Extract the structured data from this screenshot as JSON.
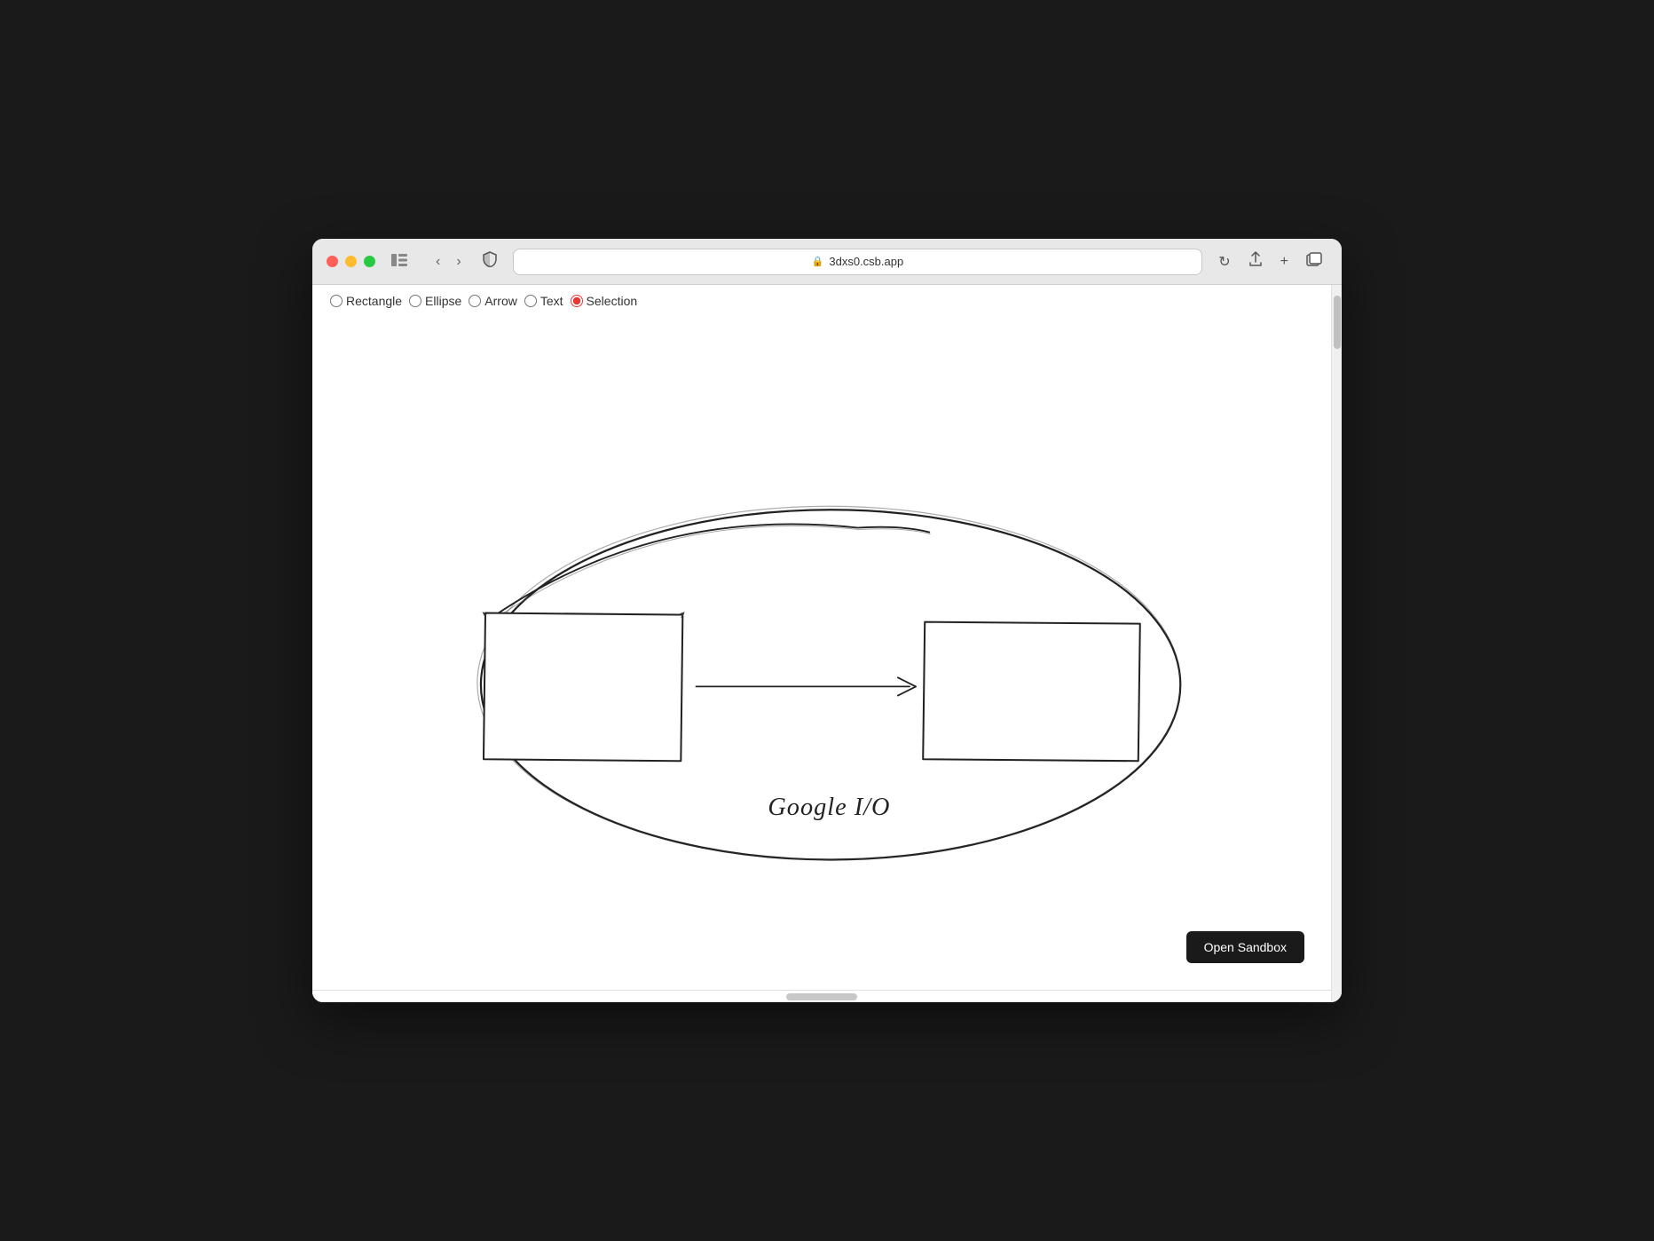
{
  "browser": {
    "url": "3dxs0.csb.app",
    "url_display": "3dxs0.csb.app"
  },
  "toolbar": {
    "tools": [
      {
        "id": "rectangle",
        "label": "Rectangle",
        "selected": false
      },
      {
        "id": "ellipse",
        "label": "Ellipse",
        "selected": false
      },
      {
        "id": "arrow",
        "label": "Arrow",
        "selected": false
      },
      {
        "id": "text",
        "label": "Text",
        "selected": false
      },
      {
        "id": "selection",
        "label": "Selection",
        "selected": true
      }
    ]
  },
  "canvas": {
    "annotation": "Google I/O"
  },
  "buttons": {
    "open_sandbox": "Open Sandbox",
    "back": "‹",
    "forward": "›"
  },
  "icons": {
    "lock": "🔒",
    "reload": "↻",
    "share": "⬆",
    "new_tab": "+",
    "tabs": "⧉",
    "sidebar": "⊟",
    "shield": "⛨"
  }
}
